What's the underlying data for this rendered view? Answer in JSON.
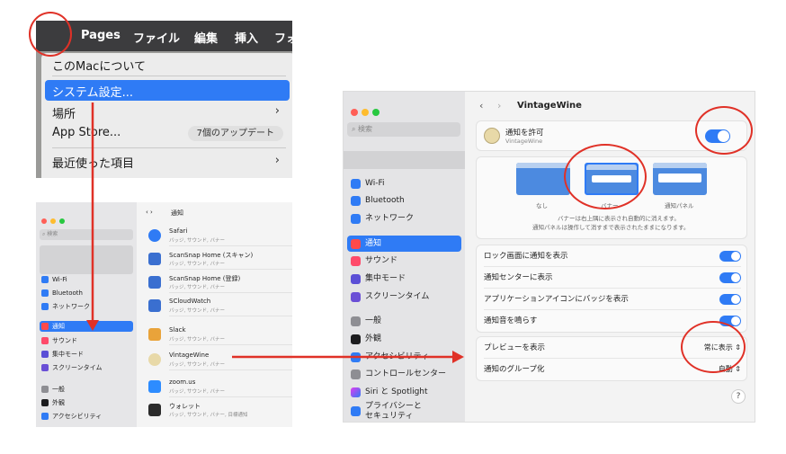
{
  "menu": {
    "menubar": [
      "Pages",
      "ファイル",
      "編集",
      "挿入",
      "フォ"
    ],
    "about": "このMacについて",
    "system_settings": "システム設定...",
    "location": "場所",
    "app_store": "App Store...",
    "app_store_badge": "7個のアップデート",
    "recent_items": "最近使った項目"
  },
  "notif_list": {
    "search_placeholder": "検索",
    "nav_title": "通知",
    "sidebar": [
      "Wi-Fi",
      "Bluetooth",
      "ネットワーク",
      "通知",
      "サウンド",
      "集中モード",
      "スクリーンタイム",
      "一般",
      "外観",
      "アクセシビリティ"
    ],
    "apps": [
      {
        "name": "Safari",
        "sub": "バッジ, サウンド, バナー"
      },
      {
        "name": "ScanSnap Home (スキャン)",
        "sub": "バッジ, サウンド, バナー"
      },
      {
        "name": "ScanSnap Home (登録)",
        "sub": "バッジ, サウンド, バナー"
      },
      {
        "name": "SCloudWatch",
        "sub": "バッジ, サウンド, バナー"
      },
      {
        "name": "Slack",
        "sub": "バッジ, サウンド, バナー"
      },
      {
        "name": "VintageWine",
        "sub": "バッジ, サウンド, バナー"
      },
      {
        "name": "zoom.us",
        "sub": "バッジ, サウンド, バナー"
      },
      {
        "name": "ウォレット",
        "sub": "バッジ, サウンド, バナー, 目標通知"
      }
    ]
  },
  "settings": {
    "search_placeholder": "検索",
    "title": "VintageWine",
    "sidebar": [
      "Wi-Fi",
      "Bluetooth",
      "ネットワーク",
      "通知",
      "サウンド",
      "集中モード",
      "スクリーンタイム",
      "一般",
      "外観",
      "アクセシビリティ",
      "コントロールセンター",
      "Siri と Spotlight",
      "プライバシーと\nセキュリティ"
    ],
    "allow_label": "通知を許可",
    "allow_app": "VintageWine",
    "styles": [
      "なし",
      "バナー",
      "通知パネル"
    ],
    "style_desc_1": "バナーは右上隅に表示され自動的に消えます。",
    "style_desc_2": "通知パネルは操作して消すまで表示されたままになります。",
    "rows": [
      "ロック画面に通知を表示",
      "通知センターに表示",
      "アプリケーションアイコンにバッジを表示",
      "通知音を鳴らす"
    ],
    "preview_label": "プレビューを表示",
    "preview_value": "常に表示",
    "grouping_label": "通知のグループ化",
    "grouping_value": "自動",
    "help": "?"
  },
  "colors": {
    "accent": "#2f7bf5",
    "annotation": "#e03127"
  }
}
